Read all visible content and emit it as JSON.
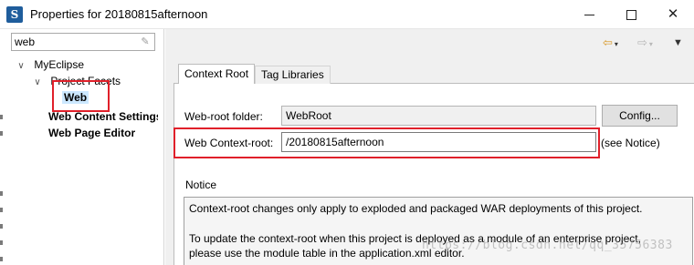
{
  "window": {
    "title": "Properties for 20180815afternoon",
    "app_icon_glyph": "S",
    "controls": [
      "minimize-icon",
      "maximize-icon",
      "close-icon"
    ]
  },
  "filter": {
    "value": "web",
    "clear_icon": "clear-filter-icon"
  },
  "tree": {
    "root": {
      "label": "MyEclipse",
      "expanded": true
    },
    "facets": {
      "label": "Project Facets",
      "expanded": true
    },
    "selected": {
      "label": "Web"
    },
    "items": [
      "Web Content Settings",
      "Web Page Editor"
    ]
  },
  "nav": {
    "back_icon": "back-arrow-icon",
    "forward_icon": "forward-arrow-icon",
    "menu_icon": "view-menu-icon"
  },
  "tabs": [
    {
      "label": "Context Root",
      "active": true
    },
    {
      "label": "Tag Libraries",
      "active": false
    }
  ],
  "form": {
    "web_root_label": "Web-root folder:",
    "web_root_value": "WebRoot",
    "config_button": "Config...",
    "context_root_label": "Web Context-root:",
    "context_root_value": "/20180815afternoon",
    "see_notice": "(see Notice)"
  },
  "notice": {
    "title": "Notice",
    "line1": "Context-root changes only apply to exploded and packaged WAR deployments of this project.",
    "line2": "To update the context-root when this project is deployed as a module of an enterprise project,",
    "line3": "please use the module table in the application.xml editor."
  },
  "watermark": "https://blog.csdn.net/qq_35756383",
  "colors": {
    "highlight_red": "#e0202a",
    "selection": "#cce8ff",
    "panel_bg": "#f0f0f0"
  }
}
